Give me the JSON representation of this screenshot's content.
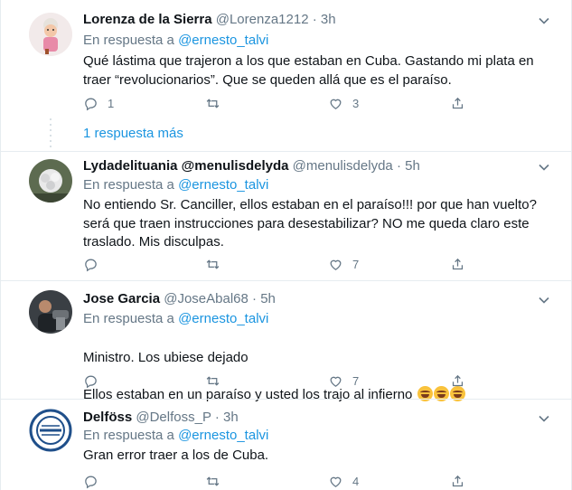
{
  "tweets": [
    {
      "name": "Lorenza de la Sierra",
      "handle": "@Lorenza1212",
      "time": "3h",
      "reply_prefix": "En respuesta a",
      "reply_to": "@ernesto_talvi",
      "text": "Qué lástima que trajeron a los que estaban en Cuba. Gastando mi plata en traer “revolucionarios”. Que se queden allá que es el paraíso.",
      "replies": "1",
      "retweets": "",
      "likes": "3",
      "avatar_icon": "grandma-cartoon-avatar"
    },
    {
      "name": "Lydadelituania @menulisdelyda",
      "handle": "@menulisdelyda",
      "time": "5h",
      "reply_prefix": "En respuesta a",
      "reply_to": "@ernesto_talvi",
      "text": "No entiendo Sr. Canciller, ellos estaban en el paraíso!!! por que han vuelto? será que traen instrucciones para desestabilizar? NO me queda claro este traslado. Mis disculpas.",
      "replies": "",
      "retweets": "",
      "likes": "7",
      "avatar_icon": "flower-photo-avatar"
    },
    {
      "name": "Jose Garcia",
      "handle": "@JoseAbal68",
      "time": "5h",
      "reply_prefix": "En respuesta a",
      "reply_to": "@ernesto_talvi",
      "text_line1": "Ministro. Los ubiese dejado",
      "text_line2": "Ellos estaban en un paraíso y usted los trajo al infierno",
      "replies": "",
      "retweets": "",
      "likes": "7",
      "avatar_icon": "man-photo-avatar"
    },
    {
      "name": "Delföss",
      "handle": "@Delfoss_P",
      "time": "3h",
      "reply_prefix": "En respuesta a",
      "reply_to": "@ernesto_talvi",
      "text": "Gran error traer a los de Cuba.",
      "replies": "",
      "retweets": "",
      "likes": "4",
      "avatar_icon": "circular-logo-avatar"
    }
  ],
  "thread": {
    "more_replies": "1 respuesta más"
  },
  "colors": {
    "link": "#1b95e0",
    "muted": "#657786",
    "border": "#e6ecf0"
  }
}
